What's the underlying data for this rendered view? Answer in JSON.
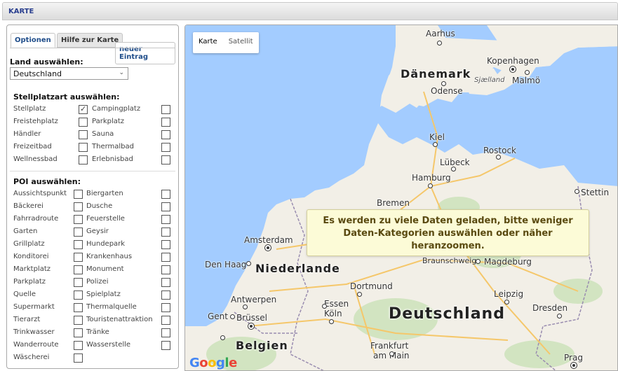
{
  "window": {
    "title": "KARTE"
  },
  "tabs": {
    "options": "Optionen",
    "help": "Hilfe zur Karte",
    "new_entry": "neuer Eintrag"
  },
  "land": {
    "label": "Land auswählen:",
    "selected": "Deutschland"
  },
  "stellplatz": {
    "title": "Stellplatzart auswählen:",
    "rows": [
      {
        "a": "Stellplatz",
        "a_checked": true,
        "b": "Campingplatz"
      },
      {
        "a": "Freistehplatz",
        "b": "Parkplatz"
      },
      {
        "a": "Händler",
        "b": "Sauna"
      },
      {
        "a": "Freizeitbad",
        "b": "Thermalbad"
      },
      {
        "a": "Wellnessbad",
        "b": "Erlebnisbad"
      }
    ]
  },
  "poi": {
    "title": "POI auswählen:",
    "rows": [
      {
        "a": "Aussichtspunkt",
        "b": "Biergarten"
      },
      {
        "a": "Bäckerei",
        "b": "Dusche"
      },
      {
        "a": "Fahrradroute",
        "b": "Feuerstelle"
      },
      {
        "a": "Garten",
        "b": "Geysir"
      },
      {
        "a": "Grillplatz",
        "b": "Hundepark"
      },
      {
        "a": "Konditorei",
        "b": "Krankenhaus"
      },
      {
        "a": "Marktplatz",
        "b": "Monument"
      },
      {
        "a": "Parkplatz",
        "b": "Polizei"
      },
      {
        "a": "Quelle",
        "b": "Spielplatz"
      },
      {
        "a": "Supermarkt",
        "b": "Thermalquelle"
      },
      {
        "a": "Tierarzt",
        "b": "Touristenattraktion"
      },
      {
        "a": "Trinkwasser",
        "b": "Tränke"
      },
      {
        "a": "Wanderroute",
        "b": "Wasserstelle"
      },
      {
        "a": "Wäscherei"
      }
    ]
  },
  "map": {
    "type_buttons": {
      "map": "Karte",
      "satellite": "Satellit"
    },
    "message": "Es werden zu viele Daten geladen, bitte weniger Daten-Kategorien auswählen oder näher heranzoomen.",
    "countries": {
      "dk": "Dänemark",
      "nl": "Niederlande",
      "de": "Deutschland",
      "be": "Belgien"
    },
    "cities": {
      "aarhus": "Aarhus",
      "kopenhagen": "Kopenhagen",
      "malmo": "Malmö",
      "odense": "Odense",
      "sjaelland": "Sjælland",
      "kiel": "Kiel",
      "rostock": "Rostock",
      "lubeck": "Lübeck",
      "hamburg": "Hamburg",
      "stettin": "Stettin",
      "bremen": "Bremen",
      "amsterdam": "Amsterdam",
      "denhaag": "Den Haag",
      "braunschweig": "Braunschweig",
      "magdeburg": "Magdeburg",
      "dortmund": "Dortmund",
      "leipzig": "Leipzig",
      "antwerpen": "Antwerpen",
      "essen": "Essen",
      "koln": "Köln",
      "dresden": "Dresden",
      "gent": "Gent",
      "brussel": "Brüssel",
      "frankfurt": "Frankfurt",
      "frankfurt2": "am Main",
      "prag": "Prag"
    },
    "logo": "Google",
    "colors": {
      "water": "#a3ccff",
      "land": "#f2efe7",
      "green": "#d2e4c1"
    }
  }
}
